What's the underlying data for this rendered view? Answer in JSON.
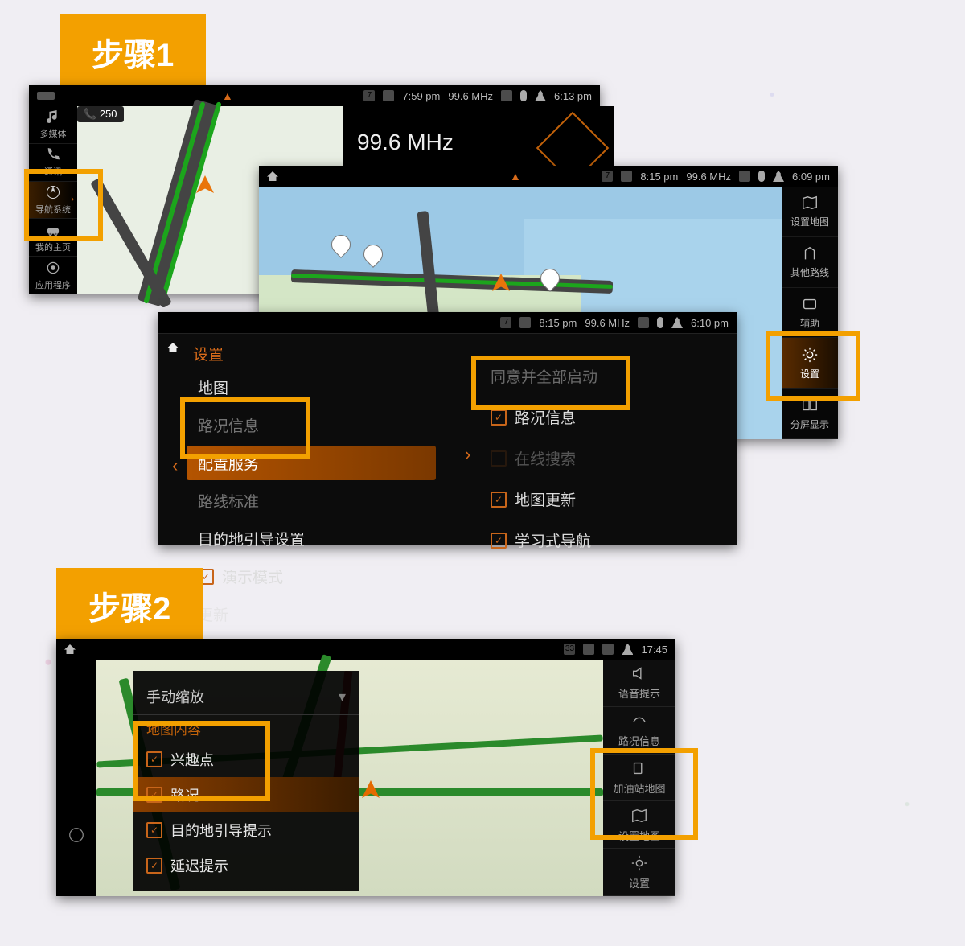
{
  "steps": {
    "one": "步骤1",
    "two": "步骤2"
  },
  "colors": {
    "accent": "#f3a000",
    "orange": "#d86b1a"
  },
  "s1a": {
    "status": {
      "time_left": "7:59 pm",
      "freq": "99.6 MHz",
      "time_right": "6:13 pm",
      "badge": "7"
    },
    "side": {
      "media": "多媒体",
      "comm": "通讯",
      "nav": "导航系统",
      "my": "我的主页",
      "apps": "应用程序"
    },
    "map": {
      "call": "250"
    },
    "radio": "99.6 MHz"
  },
  "s1b": {
    "status": {
      "time_left": "8:15 pm",
      "freq": "99.6 MHz",
      "time_right": "6:09 pm",
      "badge": "7"
    },
    "side": {
      "setmap": "设置地图",
      "routes": "其他路线",
      "third": "辅助",
      "settings": "设置",
      "split": "分屏显示"
    }
  },
  "s1c": {
    "title": "设置",
    "status": {
      "time_left": "8:15 pm",
      "freq": "99.6 MHz",
      "time_right": "6:10 pm",
      "badge": "7"
    },
    "left": {
      "map": "地图",
      "traffic": "路况信息",
      "service": "配置服务",
      "route": "路线标准",
      "dest": "目的地引导设置",
      "demo": "演示模式",
      "update": "更新"
    },
    "right": {
      "auto": "同意并全部启动",
      "traffic": "路况信息",
      "online": "在线搜索",
      "mapupd": "地图更新",
      "learn": "学习式导航"
    }
  },
  "s2": {
    "status": {
      "time": "17:45",
      "badge": "33"
    },
    "side": {
      "voice": "语音提示",
      "traffic": "路况信息",
      "fuel": "加油站地图",
      "setmap": "设置地图",
      "settings": "设置"
    },
    "panel": {
      "zoom": "手动缩放",
      "heading": "地图内容",
      "poi": "兴趣点",
      "traffic": "路况",
      "dest": "目的地引导提示",
      "delay": "延迟提示"
    }
  }
}
